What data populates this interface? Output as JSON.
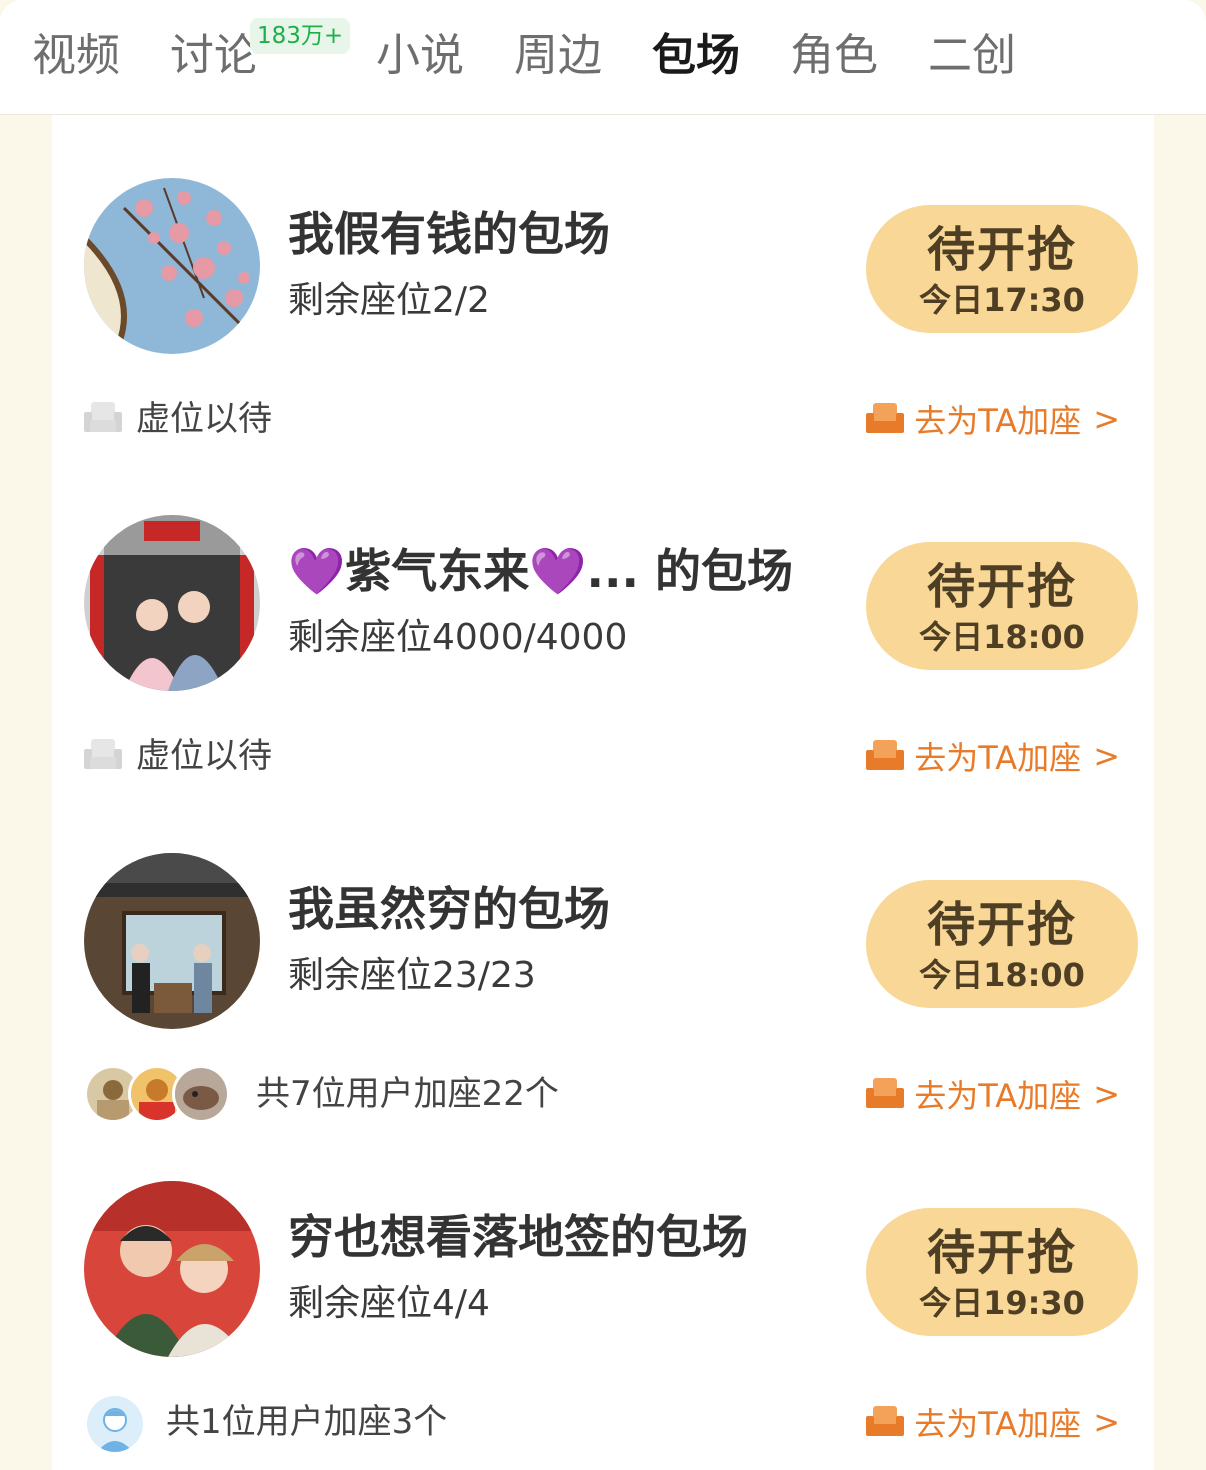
{
  "tabs": [
    {
      "label": "视频"
    },
    {
      "label": "讨论",
      "badge": "183万+"
    },
    {
      "label": "小说"
    },
    {
      "label": "周边"
    },
    {
      "label": "包场",
      "active": true
    },
    {
      "label": "角色"
    },
    {
      "label": "二创"
    }
  ],
  "sessions": [
    {
      "title": "我假有钱的包场",
      "seats": "剩余座位2/2",
      "button_label": "待开抢",
      "time": "今日17:30",
      "footer_text": "虚位以待",
      "add_link": "去为TA加座",
      "chevron": ">"
    },
    {
      "title": "💜紫气东来💜... 的包场",
      "seats": "剩余座位4000/4000",
      "button_label": "待开抢",
      "time": "今日18:00",
      "footer_text": "虚位以待",
      "add_link": "去为TA加座",
      "chevron": ">"
    },
    {
      "title": "我虽然穷的包场",
      "seats": "剩余座位23/23",
      "button_label": "待开抢",
      "time": "今日18:00",
      "footer_text": "共7位用户加座22个",
      "add_link": "去为TA加座",
      "chevron": ">"
    },
    {
      "title": "穷也想看落地签的包场",
      "seats": "剩余座位4/4",
      "button_label": "待开抢",
      "time": "今日19:30",
      "footer_text": "共1位用户加座3个",
      "add_link": "去为TA加座",
      "chevron": ">"
    }
  ],
  "colors": {
    "accent_orange": "#e87b2a",
    "button_bg": "#f9d796",
    "badge_green": "#1fae49",
    "page_bg": "#fbf8ea"
  }
}
